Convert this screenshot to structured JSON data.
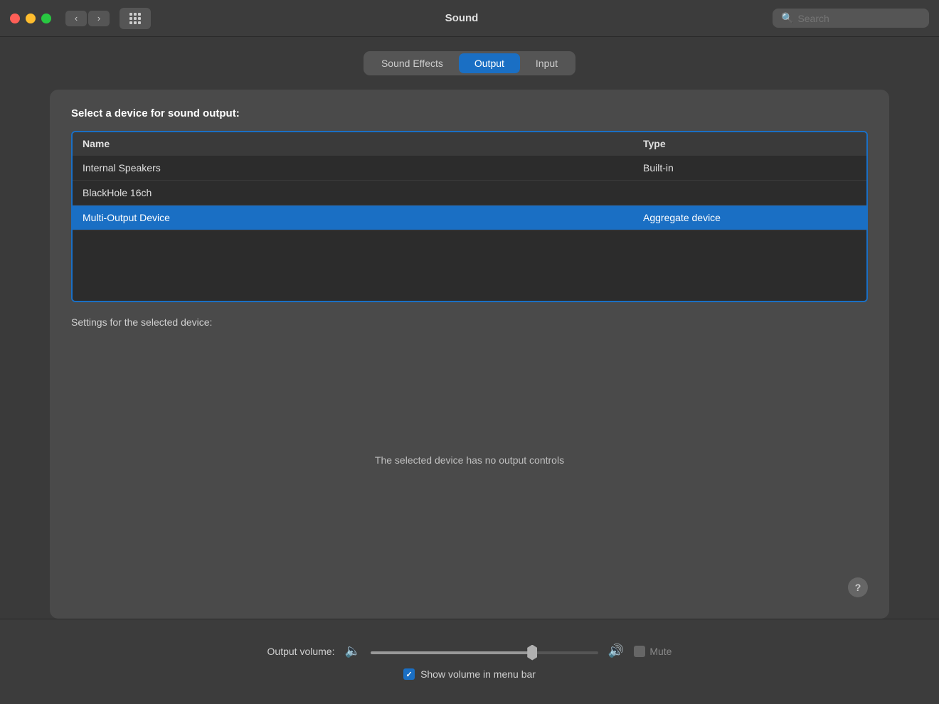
{
  "titlebar": {
    "title": "Sound",
    "search_placeholder": "Search"
  },
  "tabs": [
    {
      "id": "sound-effects",
      "label": "Sound Effects",
      "active": false
    },
    {
      "id": "output",
      "label": "Output",
      "active": true
    },
    {
      "id": "input",
      "label": "Input",
      "active": false
    }
  ],
  "panel": {
    "heading": "Select a device for sound output:",
    "table": {
      "columns": [
        {
          "id": "name",
          "label": "Name"
        },
        {
          "id": "type",
          "label": "Type"
        }
      ],
      "rows": [
        {
          "name": "Internal Speakers",
          "type": "Built-in",
          "selected": false
        },
        {
          "name": "BlackHole 16ch",
          "type": "",
          "selected": false
        },
        {
          "name": "Multi-Output Device",
          "type": "Aggregate device",
          "selected": true
        }
      ]
    },
    "settings_label": "Settings for the selected device:",
    "no_controls_text": "The selected device has no output controls",
    "help_button": "?"
  },
  "bottom": {
    "output_volume_label": "Output volume:",
    "volume_value": 72,
    "mute_label": "Mute",
    "show_in_menu_bar_label": "Show volume in menu bar",
    "show_in_menu_bar_checked": true
  }
}
